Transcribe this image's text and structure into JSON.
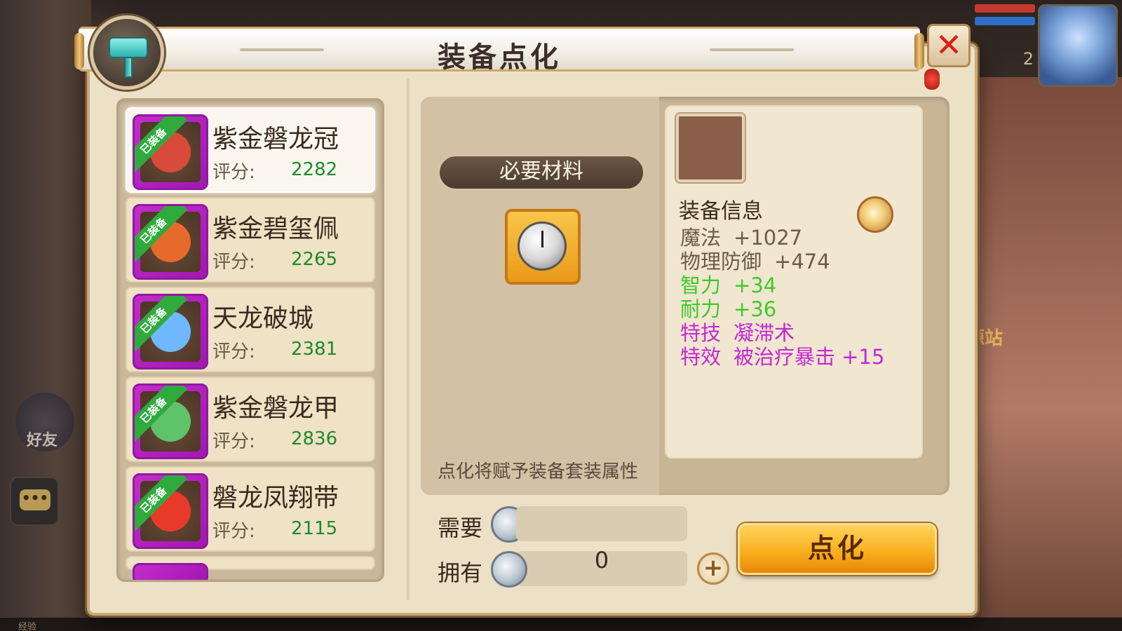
{
  "dialog": {
    "title": "装备点化",
    "close_label": "✕"
  },
  "equipment_list": [
    {
      "name": "紫金磐龙冠",
      "badge": "已装备",
      "score_label": "评分:",
      "score": "2282",
      "art_color": "#d84a3a",
      "selected": true
    },
    {
      "name": "紫金碧玺佩",
      "badge": "已装备",
      "score_label": "评分:",
      "score": "2265",
      "art_color": "#e86a2a",
      "selected": false
    },
    {
      "name": "天龙破城",
      "badge": "已装备",
      "score_label": "评分:",
      "score": "2381",
      "art_color": "#6fb8ff",
      "selected": false
    },
    {
      "name": "紫金磐龙甲",
      "badge": "已装备",
      "score_label": "评分:",
      "score": "2836",
      "art_color": "#5fc36a",
      "selected": false
    },
    {
      "name": "磐龙凤翔带",
      "badge": "已装备",
      "score_label": "评分:",
      "score": "2115",
      "art_color": "#e83a2a",
      "selected": false
    }
  ],
  "materials": {
    "banner": "必要材料",
    "item_icon": "stopwatch-icon",
    "hint": "点化将赋予装备套装属性"
  },
  "info": {
    "title": "装备信息",
    "stats": [
      {
        "key": "魔法",
        "value": "+1027",
        "tone": "base"
      },
      {
        "key": "物理防御",
        "value": "+474",
        "tone": "base"
      },
      {
        "key": "智力",
        "value": "+34",
        "tone": "green"
      },
      {
        "key": "耐力",
        "value": "+36",
        "tone": "green"
      },
      {
        "key": "特技",
        "value": "凝滞术",
        "tone": "purple"
      },
      {
        "key": "特效",
        "value": "被治疗暴击 +15",
        "tone": "purple"
      }
    ]
  },
  "cost": {
    "need_label": "需要",
    "need_value": "",
    "own_label": "拥有",
    "own_value": "0",
    "plus_label": "+"
  },
  "action": {
    "label": "点化"
  },
  "hud": {
    "friend_label": "好友",
    "chat_label": "•••",
    "exp_label": "经验",
    "level": "2",
    "resource_text": "资源站"
  },
  "colors": {
    "panel": "#ece0c6",
    "green_stat": "#3ec92c",
    "purple_stat": "#c229d4",
    "score": "#1e8a2c",
    "button": "#f7ad1c"
  }
}
